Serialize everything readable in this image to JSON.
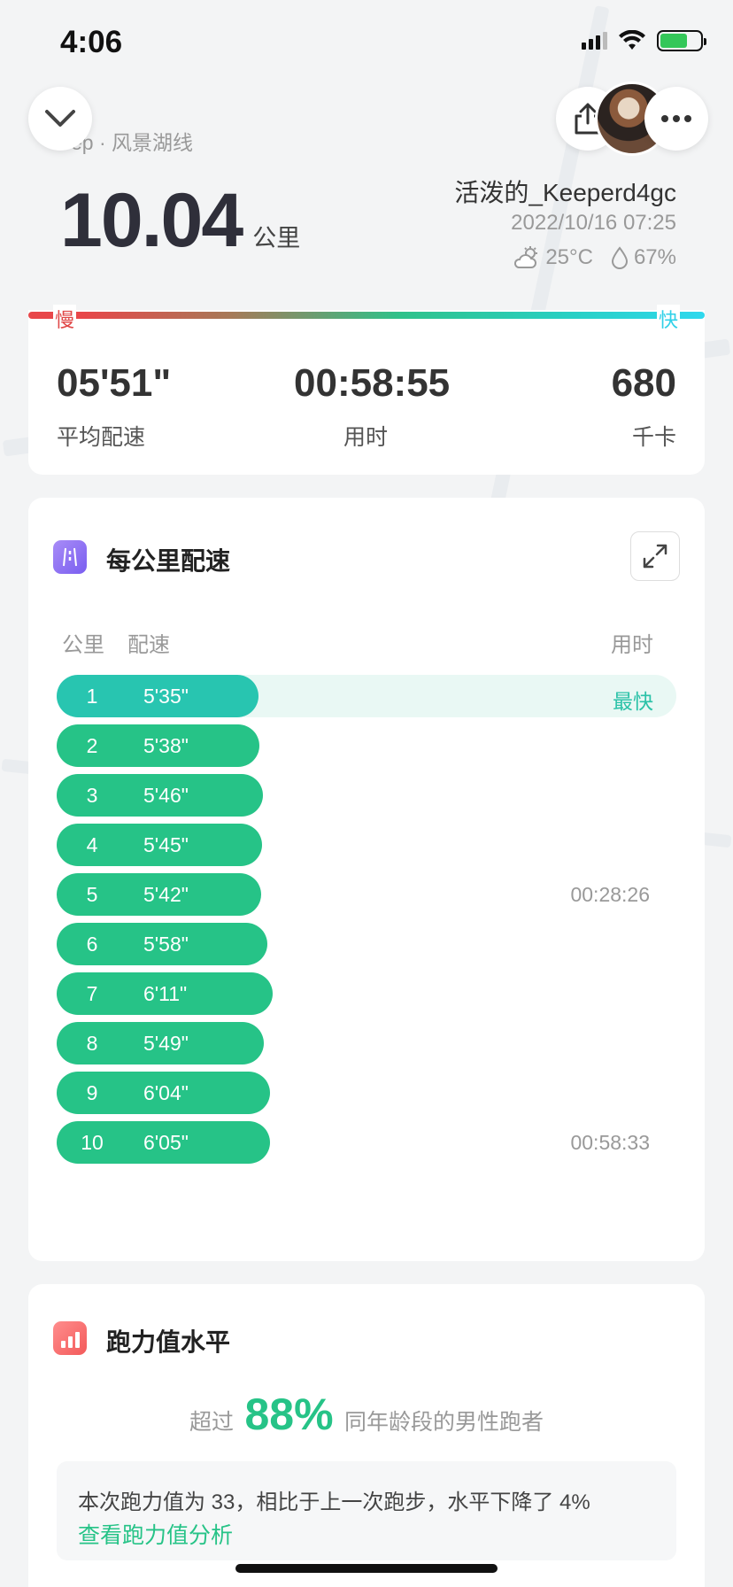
{
  "status_bar": {
    "time": "4:06"
  },
  "header": {
    "route_name": "ep · 风景湖线",
    "distance": "10.04",
    "distance_unit": "公里",
    "user_name": "活泼的_Keeperd4gc",
    "datetime": "2022/10/16 07:25",
    "temperature": "25°C",
    "humidity": "67%",
    "icons": [
      "chevron-down-icon",
      "share-icon",
      "more-icon",
      "weather-cloud-sun-icon",
      "humidity-drop-icon"
    ]
  },
  "summary": {
    "slow_label": "慢",
    "fast_label": "快",
    "stats": [
      {
        "value": "05'51\"",
        "label": "平均配速"
      },
      {
        "value": "00:58:55",
        "label": "用时"
      },
      {
        "value": "680",
        "label": "千卡"
      }
    ]
  },
  "pace_section": {
    "title": "每公里配速",
    "col_km": "公里",
    "col_pace": "配速",
    "col_time": "用时",
    "best_label": "最快",
    "accent_color": "#26c387",
    "rows": [
      {
        "km": "1",
        "pace": "5'35\"",
        "pace_seconds": 335,
        "time": ""
      },
      {
        "km": "2",
        "pace": "5'38\"",
        "pace_seconds": 338,
        "time": ""
      },
      {
        "km": "3",
        "pace": "5'46\"",
        "pace_seconds": 346,
        "time": ""
      },
      {
        "km": "4",
        "pace": "5'45\"",
        "pace_seconds": 345,
        "time": ""
      },
      {
        "km": "5",
        "pace": "5'42\"",
        "pace_seconds": 342,
        "time": "00:28:26"
      },
      {
        "km": "6",
        "pace": "5'58\"",
        "pace_seconds": 358,
        "time": ""
      },
      {
        "km": "7",
        "pace": "6'11\"",
        "pace_seconds": 371,
        "time": ""
      },
      {
        "km": "8",
        "pace": "5'49\"",
        "pace_seconds": 349,
        "time": ""
      },
      {
        "km": "9",
        "pace": "6'04\"",
        "pace_seconds": 364,
        "time": ""
      },
      {
        "km": "10",
        "pace": "6'05\"",
        "pace_seconds": 365,
        "time": "00:58:33"
      }
    ]
  },
  "power_section": {
    "title": "跑力值水平",
    "exceed_prefix": "超过",
    "exceed_percent": "88%",
    "exceed_suffix": "同年龄段的男性跑者",
    "analysis_text": "本次跑力值为 33，相比于上一次跑步，水平下降了 4%",
    "analysis_link": "查看跑力值分析"
  }
}
